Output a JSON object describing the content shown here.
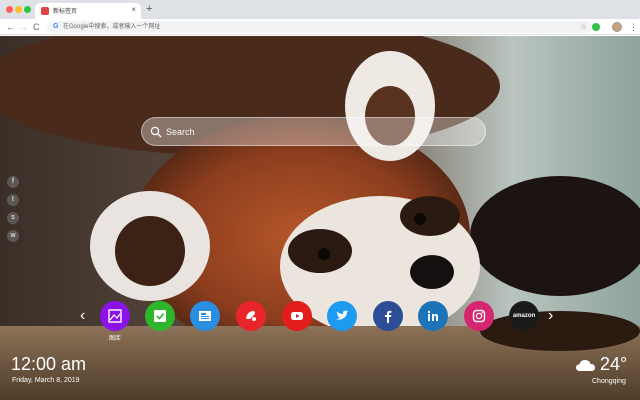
{
  "browser": {
    "tab_title": "新标签页",
    "tab_close": "×",
    "new_tab": "+",
    "back": "←",
    "forward": "→",
    "reload": "C",
    "omnibox_g": "G",
    "omnibox_placeholder": "在Google中搜索，或者输入一个网址",
    "star": "☆",
    "menu": "⋮"
  },
  "search": {
    "placeholder": "Search",
    "icon": "search-icon"
  },
  "social": [
    {
      "name": "facebook",
      "glyph": "f"
    },
    {
      "name": "twitter",
      "glyph": "t"
    },
    {
      "name": "snapchat",
      "glyph": "s"
    },
    {
      "name": "wechat",
      "glyph": "w"
    }
  ],
  "dock": {
    "prev": "‹",
    "next": "›",
    "apps": [
      {
        "name": "gallery",
        "label": "图库",
        "color": "#8b12e8"
      },
      {
        "name": "checkmark",
        "label": "",
        "color": "#2fb52b"
      },
      {
        "name": "news",
        "label": "",
        "color": "#2a8ee0"
      },
      {
        "name": "game",
        "label": "",
        "color": "#e8262a"
      },
      {
        "name": "youtube",
        "label": "",
        "color": "#e31c1c"
      },
      {
        "name": "twitter",
        "label": "",
        "color": "#1d9bf0"
      },
      {
        "name": "facebook",
        "label": "",
        "color": "#2d4e96"
      },
      {
        "name": "linkedin",
        "label": "",
        "color": "#1c74b8"
      },
      {
        "name": "instagram",
        "label": "",
        "color": "#d6266f"
      },
      {
        "name": "amazon",
        "label": "amazon",
        "color": "#1a1a1a"
      }
    ]
  },
  "clock": {
    "time": "12:00 am",
    "date": "Friday, March 8, 2019"
  },
  "weather": {
    "temp": "24°",
    "city": "Chongqing",
    "icon": "cloud-icon"
  }
}
